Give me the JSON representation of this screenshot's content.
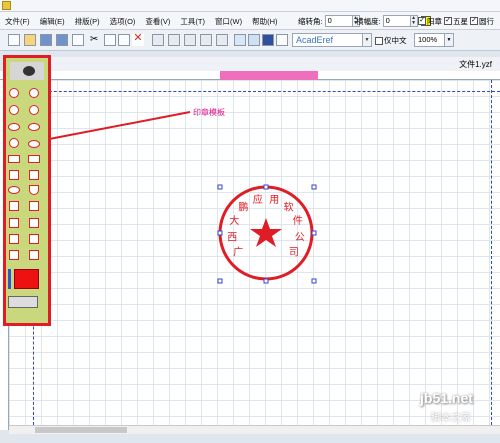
{
  "menu": {
    "items": [
      "文件(F)",
      "编辑(E)",
      "排版(P)",
      "选项(O)",
      "查看(V)",
      "工具(T)",
      "窗口(W)",
      "帮助(H)"
    ]
  },
  "props": {
    "rotate_label": "缩转角:",
    "rotate_value": "0",
    "hscale_label": "横幅度:",
    "hscale_value": "0",
    "yang_label": "阳章",
    "star_label": "五星",
    "tone_label": "圆行"
  },
  "font": {
    "name": "AcadEref"
  },
  "vertical": {
    "label": "仅中文"
  },
  "zoom": {
    "value": "100%"
  },
  "document": {
    "tab": "文件1.yzf"
  },
  "annotation": {
    "text": "印章模板"
  },
  "seal": {
    "text": "广西大鹏应用软件公司",
    "color": "#e01c24"
  },
  "watermark": {
    "line1": "jb51.net",
    "line2": "脚本之家"
  }
}
